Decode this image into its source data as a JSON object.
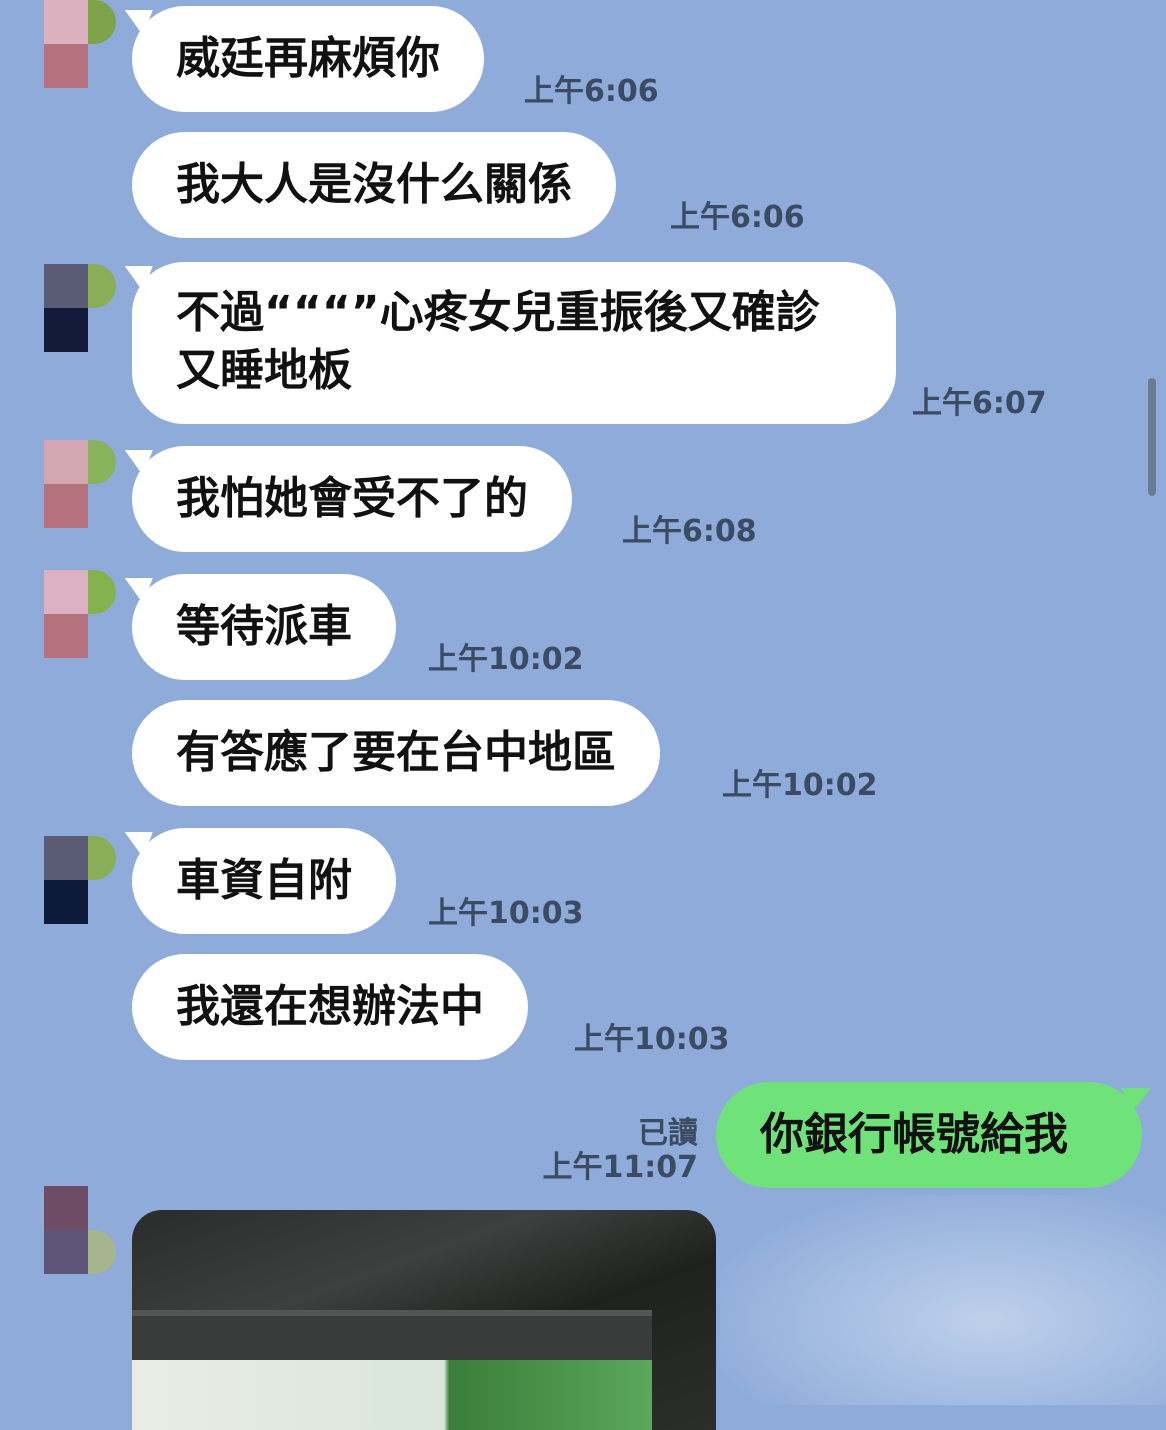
{
  "colors": {
    "background": "#8eabd9",
    "incoming_bubble": "#ffffff",
    "outgoing_bubble": "#6fe27a",
    "timestamp_text": "#3b4b63"
  },
  "messages": [
    {
      "text": "威廷再麻煩你",
      "time": "上午6:06"
    },
    {
      "text": "我大人是沒什么關係",
      "time": "上午6:06"
    },
    {
      "text": "不過“““”心疼女兒重振後又確診又睡地板",
      "time": "上午6:07"
    },
    {
      "text": "我怕她會受不了的",
      "time": "上午6:08"
    },
    {
      "text": "等待派車",
      "time": "上午10:02"
    },
    {
      "text": "有答應了要在台中地區",
      "time": "上午10:02"
    },
    {
      "text": "車資自附",
      "time": "上午10:03"
    },
    {
      "text": "我還在想辦法中",
      "time": "上午10:03"
    }
  ],
  "outgoing": {
    "text": "你銀行帳號給我",
    "read_label": "已讀",
    "time": "上午11:07"
  },
  "image_message": {
    "icon": "photo-icon"
  }
}
